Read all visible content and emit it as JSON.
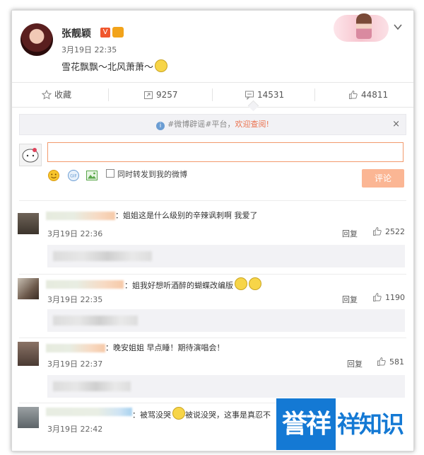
{
  "post": {
    "username": "张靓颖",
    "vip_badge": "V",
    "time": "3月19日 22:35",
    "text": "雪花飘飘～北风萧萧～"
  },
  "actions": {
    "favorite": "收藏",
    "repost": "9257",
    "comment": "14531",
    "like": "44811"
  },
  "notice": {
    "prefix": "#微博辟谣#平台，",
    "link": "欢迎查阅!",
    "close": "×"
  },
  "composer": {
    "forward_label": "同时转发到我的微博",
    "submit_label": "评论"
  },
  "comments": [
    {
      "text": "：姐姐这是什么级别的辛辣讽刺啊 我爱了",
      "time": "3月19日 22:36",
      "reply": "回复",
      "likes": "2522"
    },
    {
      "text": "：姐我好想听酒醉的蝴蝶改编版",
      "time": "3月19日 22:35",
      "reply": "回复",
      "likes": "1190"
    },
    {
      "text": "：晚安姐姐 早点睡！期待演唱会！",
      "time": "3月19日 22:37",
      "reply": "回复",
      "likes": "581"
    },
    {
      "text": "：被骂没哭",
      "text2": "被说没哭，这事是真忍不",
      "time": "3月19日 22:42"
    }
  ],
  "watermark": {
    "left": "誉祥",
    "right": "祥知识"
  },
  "colors": {
    "accent": "#eb7350",
    "link_blue": "#6b9dd3",
    "watermark_blue": "#1479d4",
    "button_disabled": "#fbb694"
  }
}
